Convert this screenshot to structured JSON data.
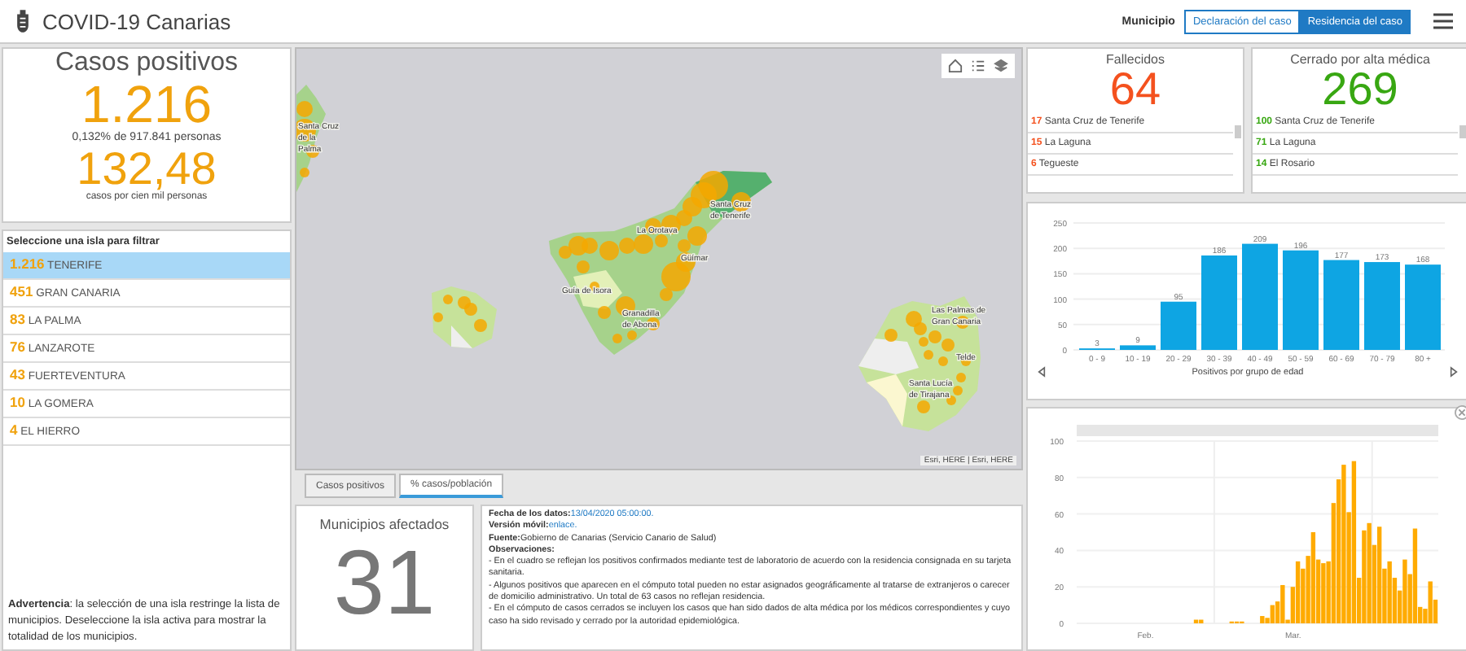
{
  "header": {
    "title": "COVID-19 Canarias",
    "filter_label": "Municipio",
    "toggles": [
      {
        "label": "Declaración del caso",
        "selected": false
      },
      {
        "label": "Residencia del caso",
        "selected": true
      }
    ]
  },
  "cases": {
    "title": "Casos positivos",
    "total": "1.216",
    "share": "0,132% de 917.841 personas",
    "rate": "132,48",
    "rate_caption": "casos por cien mil personas"
  },
  "islands": {
    "heading": "Seleccione una isla para filtrar",
    "items": [
      {
        "count": "1.216",
        "name": "TENERIFE",
        "selected": true
      },
      {
        "count": "451",
        "name": "GRAN CANARIA",
        "selected": false
      },
      {
        "count": "83",
        "name": "LA PALMA",
        "selected": false
      },
      {
        "count": "76",
        "name": "LANZAROTE",
        "selected": false
      },
      {
        "count": "43",
        "name": "FUERTEVENTURA",
        "selected": false
      },
      {
        "count": "10",
        "name": "LA GOMERA",
        "selected": false
      },
      {
        "count": "4",
        "name": "EL HIERRO",
        "selected": false
      }
    ],
    "warning": "**Advertencia**: la selección de una isla restringe la lista de municipios. Deseleccione la isla activa para mostrar la totalidad de los municipios."
  },
  "map": {
    "labels": [
      {
        "lines": [
          "Santa Cruz",
          "de la",
          "Palma"
        ]
      },
      {
        "lines": [
          "Santa Cruz",
          "de Tenerife"
        ]
      },
      {
        "lines": [
          "La Orotava"
        ]
      },
      {
        "lines": [
          "Güímar"
        ]
      },
      {
        "lines": [
          "Guía de Isora"
        ]
      },
      {
        "lines": [
          "Granadilla",
          "de Abona"
        ]
      },
      {
        "lines": [
          "Las Palmas de",
          "Gran Canaria"
        ]
      },
      {
        "lines": [
          "Telde"
        ]
      },
      {
        "lines": [
          "Santa Lucía",
          "de Tirajana"
        ]
      }
    ],
    "attribution": "Esri, HERE | Esri, HERE",
    "tabs": [
      {
        "label": "Casos positivos",
        "selected": false
      },
      {
        "label": "% casos/población",
        "selected": true
      }
    ]
  },
  "municipalities": {
    "title": "Municipios afectados",
    "count": "31"
  },
  "info": {
    "fields": [
      {
        "kind": "link",
        "label": "Fecha de los datos:",
        "value": "13/04/2020 05:00:00."
      },
      {
        "kind": "link",
        "label": "Versión móvil:",
        "value": "enlace."
      },
      {
        "kind": "text",
        "label": "Fuente:",
        "value": "Gobierno de Canarias (Servicio Canario de Salud)"
      },
      {
        "kind": "heading",
        "label": "Observaciones:"
      }
    ],
    "notes": [
      "- En el cuadro se reflejan los positivos confirmados mediante test de laboratorio de acuerdo con la residencia consignada en su tarjeta sanitaria.",
      "- Algunos positivos que aparecen en el cómputo total pueden no estar asignados geográficamente al tratarse de extranjeros o carecer de domicilio administrativo. Un total de 63 casos no reflejan residencia.",
      "- En el cómputo de casos cerrados se incluyen los casos que han sido dados de alta médica por los médicos correspondientes y cuyo caso ha sido revisado y cerrado por la autoridad epidemiológica."
    ]
  },
  "deaths": {
    "title": "Fallecidos",
    "total": "64",
    "rows": [
      {
        "count": "17",
        "name": "Santa Cruz de Tenerife"
      },
      {
        "count": "15",
        "name": "La Laguna"
      },
      {
        "count": "6",
        "name": "Tegueste"
      }
    ]
  },
  "recovered": {
    "title": "Cerrado por alta médica",
    "total": "269",
    "rows": [
      {
        "count": "100",
        "name": "Santa Cruz de Tenerife"
      },
      {
        "count": "71",
        "name": "La Laguna"
      },
      {
        "count": "14",
        "name": "El Rosario"
      }
    ]
  },
  "age_chart": {
    "chart_data": {
      "type": "bar",
      "xlabel": "Positivos por grupo de edad",
      "categories": [
        "0 - 9",
        "10 - 19",
        "20 - 29",
        "30 - 39",
        "40 - 49",
        "50 - 59",
        "60 - 69",
        "70 - 79",
        "80 +"
      ],
      "values": [
        3,
        9,
        95,
        186,
        209,
        196,
        177,
        173,
        168
      ],
      "ylim": [
        0,
        250
      ],
      "yticks": [
        0,
        50,
        100,
        150,
        200,
        250
      ],
      "data_labels": true,
      "grid": true
    }
  },
  "timeline": {
    "month_labels": [
      "Feb.",
      "Mar."
    ],
    "chart_data": {
      "type": "bar",
      "ylim": [
        0,
        100
      ],
      "yticks": [
        0,
        20,
        40,
        60,
        80,
        100
      ],
      "grid": true,
      "values": [
        0,
        0,
        0,
        0,
        0,
        0,
        0,
        0,
        0,
        0,
        0,
        0,
        0,
        0,
        0,
        0,
        0,
        0,
        0,
        0,
        0,
        0,
        0,
        2,
        2,
        0,
        0,
        0,
        0,
        0,
        1,
        1,
        1,
        0,
        0,
        0,
        4,
        3,
        10,
        12,
        21,
        2,
        20,
        34,
        30,
        37,
        50,
        35,
        33,
        34,
        66,
        79,
        87,
        61,
        89,
        25,
        51,
        55,
        43,
        53,
        30,
        34,
        25,
        18,
        35,
        27,
        52,
        9,
        8,
        23,
        13
      ]
    }
  }
}
